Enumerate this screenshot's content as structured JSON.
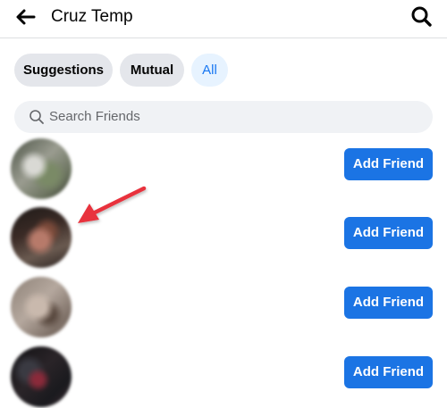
{
  "header": {
    "back_icon": "back-arrow-icon",
    "title": "Cruz Temp",
    "search_icon": "search-icon"
  },
  "filters": [
    {
      "label": "Suggestions",
      "selected": false
    },
    {
      "label": "Mutual",
      "selected": false
    },
    {
      "label": "All",
      "selected": true
    }
  ],
  "search": {
    "icon": "magnifier-icon",
    "placeholder": "Search Friends"
  },
  "friends": [
    {
      "avatar": "blurred-profile-photo",
      "action_label": "Add Friend"
    },
    {
      "avatar": "blurred-profile-photo",
      "action_label": "Add Friend"
    },
    {
      "avatar": "blurred-profile-photo",
      "action_label": "Add Friend"
    },
    {
      "avatar": "blurred-profile-photo",
      "action_label": "Add Friend"
    }
  ],
  "annotation": {
    "icon": "red-pointer-arrow",
    "color": "#e8323c"
  },
  "colors": {
    "accent": "#1b74e4",
    "chip_bg": "#e4e6eb",
    "selected_chip_bg": "#e7f3ff",
    "selected_chip_text": "#1877f2"
  }
}
